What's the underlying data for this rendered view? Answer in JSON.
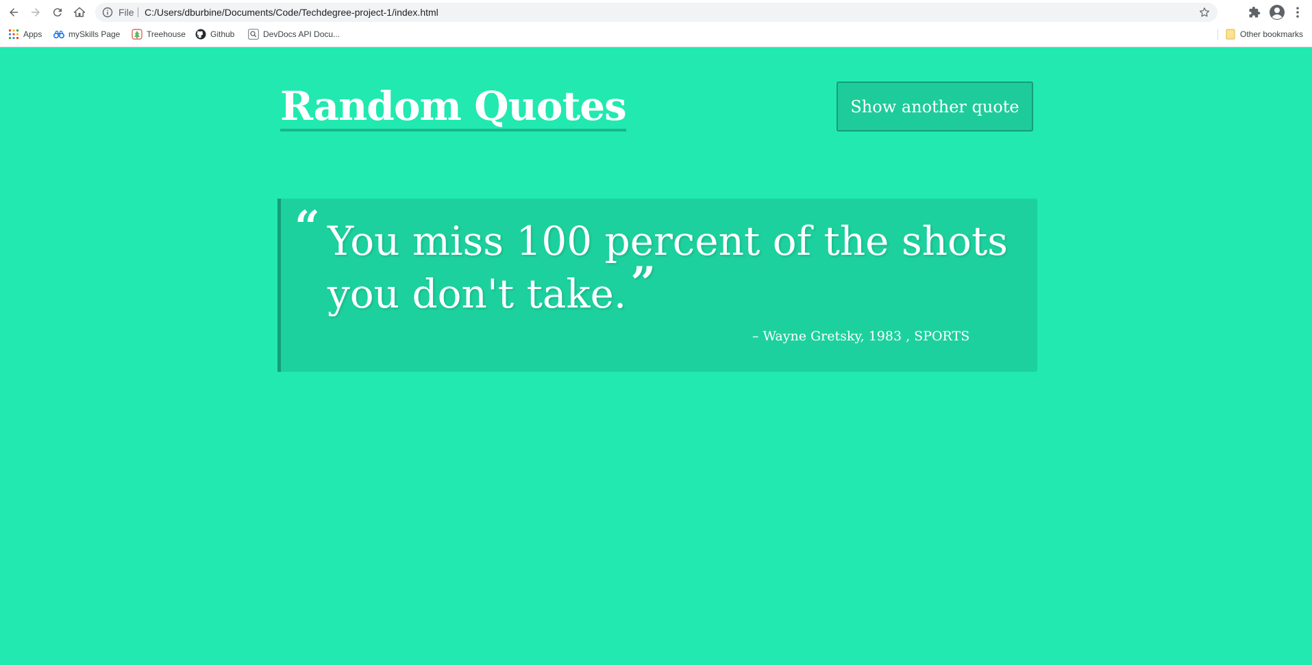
{
  "browser": {
    "scheme_label": "File",
    "url": "C:/Users/dburbine/Documents/Code/Techdegree-project-1/index.html",
    "bookmarks": [
      {
        "label": "Apps"
      },
      {
        "label": "mySkills Page"
      },
      {
        "label": "Treehouse"
      },
      {
        "label": "Github"
      },
      {
        "label": "DevDocs API Docu..."
      }
    ],
    "other_bookmarks_label": "Other bookmarks"
  },
  "page": {
    "title": "Random Quotes",
    "button_label": "Show another quote",
    "background_color": "#21e9b0",
    "quote": {
      "open_mark": "“",
      "text": "You miss 100 percent of the shots you don't take.",
      "close_mark": "”",
      "source_prefix": "– ",
      "source": "Wayne Gretsky, 1983 , SPORTS"
    }
  }
}
